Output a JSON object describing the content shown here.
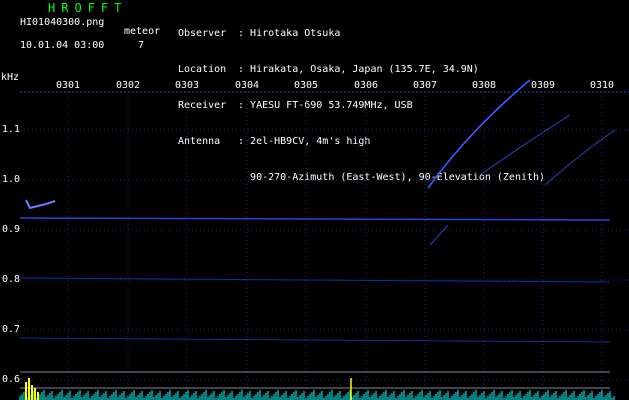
{
  "app_title": "HROFFT",
  "file_name": "HI01040300.png",
  "meteor_label": "meteor",
  "timestamp": "10.01.04 03:00",
  "meteor_count": "7",
  "info": [
    {
      "key": "Observer",
      "value": "Hirotaka Otsuka"
    },
    {
      "key": "Location",
      "value": "Hirakata, Osaka, Japan (135.7E, 34.9N)"
    },
    {
      "key": "Receiver",
      "value": "YAESU FT-690 53.749MHz, USB"
    },
    {
      "key": "Antenna",
      "value": "2el-HB9CV, 4m's high"
    },
    {
      "key": "",
      "value": "90-270-Azimuth (East-West), 90-Elevation (Zenith)"
    }
  ],
  "y_axis_unit": "kHz",
  "x_ticks": [
    "0301",
    "0302",
    "0303",
    "0304",
    "0305",
    "0306",
    "0307",
    "0308",
    "0309",
    "0310"
  ],
  "y_ticks": [
    "1.1",
    "1.0",
    "0.9",
    "0.8",
    "0.7",
    "0.6"
  ],
  "colors": {
    "title": "#00ff00",
    "signal": "#3a5bff",
    "grid": "#1a2a7a",
    "meteor": "#ffff00",
    "noise": "#00ffff"
  }
}
